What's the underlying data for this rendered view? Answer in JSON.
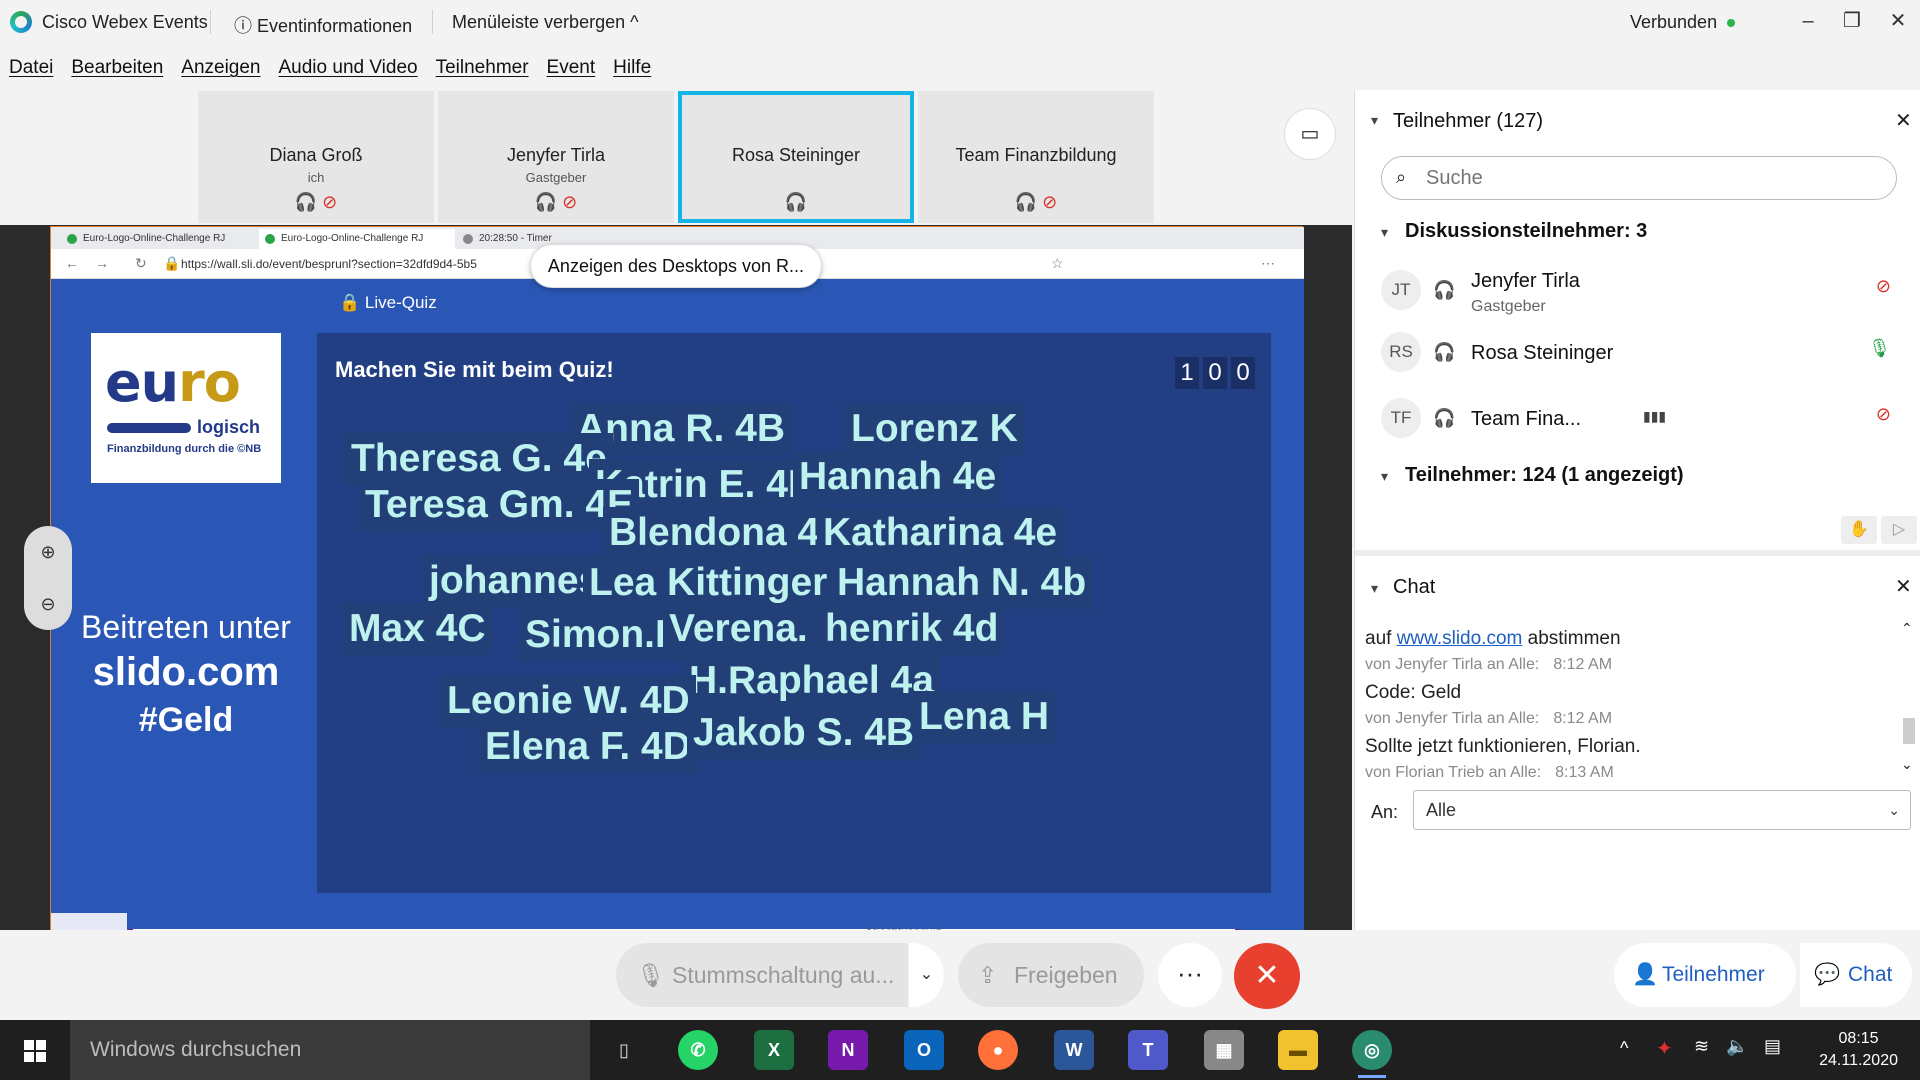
{
  "app": {
    "title": "Cisco Webex Events",
    "event_info": "Eventinformationen",
    "hide_menu": "Menüleiste verbergen",
    "status": "Verbunden"
  },
  "menu": [
    "Datei",
    "Bearbeiten",
    "Anzeigen",
    "Audio und Video",
    "Teilnehmer",
    "Event",
    "Hilfe"
  ],
  "video_tiles": [
    {
      "name": "Diana Groß",
      "role": "ich",
      "muted": true
    },
    {
      "name": "Jenyfer Tirla",
      "role": "Gastgeber",
      "muted": true
    },
    {
      "name": "Rosa Steininger",
      "role": "",
      "muted": false
    },
    {
      "name": "Team Finanzbildung",
      "role": "",
      "muted": true
    }
  ],
  "browser": {
    "tabs": [
      "Euro-Logo-Online-Challenge RJ",
      "Euro-Logo-Online-Challenge RJ",
      "20:28:50 - Timer"
    ],
    "url": "https://wall.sli.do/event/besprunl?section=32dfd9d4-5b5",
    "share_tooltip": "Anzeigen des Desktops von R..."
  },
  "slide": {
    "live_quiz": "Live-Quiz",
    "logo": {
      "euro_a": "eu",
      "euro_b": "ro",
      "logisch": "logisch",
      "tagline": "Finanzbildung durch die ©NB"
    },
    "join_line1": "Beitreten unter",
    "join_line2": "slido.com",
    "join_line3": "#Geld",
    "quiz_title": "Machen Sie mit beim Quiz!",
    "counter": [
      "1",
      "0",
      "0"
    ],
    "names": [
      "Anna R. 4B",
      "Lorenz K",
      "Theresa G. 4e",
      "Katrin E. 4E",
      "Hannah 4e",
      "Teresa Gm. 4E",
      "Blendona 4c",
      "Katharina 4e",
      "johannes",
      "Lea Kittinger 4a",
      "Hannah N. 4b",
      "Max 4C",
      "Simon.K",
      "Verena. S",
      "henrik 4d",
      "H.Raphael 4a",
      "Leonie W. 4D",
      "Lena H",
      "Elena F. 4D",
      "Jakob S. 4B"
    ],
    "footer_text": "Abschlussquiz"
  },
  "toolbar": {
    "mute": "Stummschaltung au...",
    "share": "Freigeben",
    "more": "···",
    "participants": "Teilnehmer",
    "chat": "Chat"
  },
  "participants_panel": {
    "title": "Teilnehmer (127)",
    "search_placeholder": "Suche",
    "panelists_header": "Diskussionsteilnehmer: 3",
    "panelists": [
      {
        "initials": "JT",
        "name": "Jenyfer Tirla",
        "role": "Gastgeber",
        "mic": "off"
      },
      {
        "initials": "RS",
        "name": "Rosa Steininger",
        "role": "",
        "mic": "on"
      },
      {
        "initials": "TF",
        "name": "Team Fina...",
        "role": "",
        "mic": "off"
      }
    ],
    "attendees_header": "Teilnehmer: 124 (1 angezeigt)"
  },
  "chat_panel": {
    "title": "Chat",
    "messages": [
      {
        "prefix": "auf ",
        "link": "www.slido.com",
        "suffix": " abstimmen",
        "meta": "von Jenyfer Tirla an Alle:",
        "time": "8:12 AM"
      },
      {
        "text": "Code: Geld",
        "meta": "von Jenyfer Tirla an Alle:",
        "time": "8:12 AM"
      },
      {
        "text": "Sollte jetzt funktionieren, Florian.",
        "meta": "von Florian Trieb an Alle:",
        "time": "8:13 AM"
      }
    ],
    "to_label": "An:",
    "to_value": "Alle"
  },
  "taskbar": {
    "search": "Windows durchsuchen",
    "time": "08:15",
    "date": "24.11.2020"
  },
  "colors": {
    "accent": "#13b4e6",
    "end": "#e8402f",
    "slide_bg": "#2a57b5",
    "quiz_bg": "#213f82"
  }
}
